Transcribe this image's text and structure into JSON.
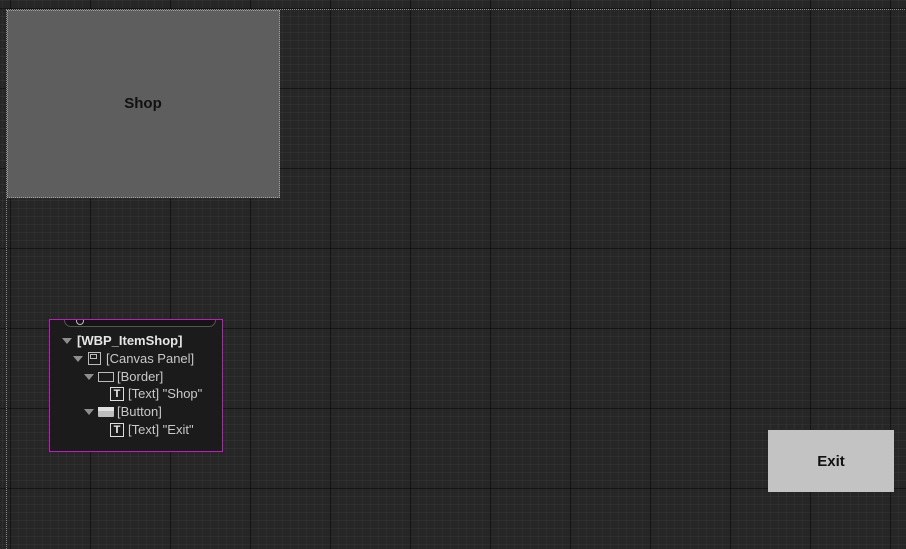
{
  "canvas": {
    "shop_label": "Shop",
    "exit_label": "Exit"
  },
  "hierarchy": {
    "root": "[WBP_ItemShop]",
    "items": [
      {
        "label": "[Canvas Panel]",
        "icon": "canvas-panel-icon"
      },
      {
        "label": "[Border]",
        "icon": "border-icon"
      },
      {
        "label": "[Text] \"Shop\"",
        "icon": "text-widget-icon"
      },
      {
        "label": "[Button]",
        "icon": "button-widget-icon"
      },
      {
        "label": "[Text] \"Exit\"",
        "icon": "text-widget-icon"
      }
    ],
    "text_icon_glyph": "T"
  },
  "colors": {
    "background": "#262626",
    "shop_border_fill": "#5e5e5e",
    "exit_button_fill": "#c3c3c3",
    "selection_outline": "#c21bc2"
  }
}
